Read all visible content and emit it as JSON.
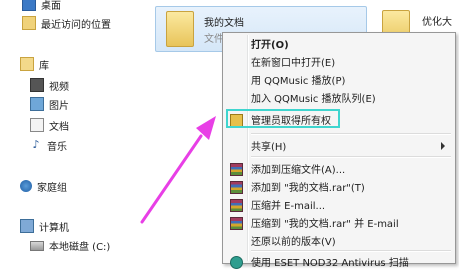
{
  "sidebar": {
    "items": [
      {
        "label": "桌面",
        "icon": "desktop-icon"
      },
      {
        "label": "最近访问的位置",
        "icon": "recent-places-icon"
      },
      {
        "label": "库",
        "icon": "libraries-icon"
      },
      {
        "label": "视频",
        "icon": "videos-icon"
      },
      {
        "label": "图片",
        "icon": "pictures-icon"
      },
      {
        "label": "文档",
        "icon": "documents-icon"
      },
      {
        "label": "音乐",
        "icon": "music-icon"
      },
      {
        "label": "家庭组",
        "icon": "homegroup-icon"
      },
      {
        "label": "计算机",
        "icon": "computer-icon"
      },
      {
        "label": "本地磁盘 (C:)",
        "icon": "local-disk-icon"
      }
    ]
  },
  "content": {
    "selected_folder": {
      "name": "我的文档",
      "sub": "文件"
    },
    "other_folder": {
      "name": "优化大"
    }
  },
  "context_menu": {
    "items": [
      {
        "label": "打开(O)",
        "bold": true
      },
      {
        "label": "在新窗口中打开(E)"
      },
      {
        "label": "用 QQMusic 播放(P)"
      },
      {
        "label": "加入 QQMusic 播放队列(E)"
      },
      {
        "label": "管理员取得所有权",
        "highlighted": true
      },
      {
        "label": "共享(H)",
        "submenu": true
      },
      {
        "label": "添加到压缩文件(A)...",
        "icon": "winrar-icon"
      },
      {
        "label": "添加到 \"我的文档.rar\"(T)",
        "icon": "winrar-icon"
      },
      {
        "label": "压缩并 E-mail...",
        "icon": "winrar-icon"
      },
      {
        "label": "压缩到 \"我的文档.rar\" 并 E-mail",
        "icon": "winrar-icon"
      },
      {
        "label": "还原以前的版本(V)"
      },
      {
        "label": "使用 ESET NOD32 Antivirus 扫描",
        "icon": "eset-icon"
      }
    ]
  },
  "colors": {
    "highlight": "#3fd5cf",
    "arrow": "#e83fe6",
    "selection": "#cfe3f8"
  }
}
